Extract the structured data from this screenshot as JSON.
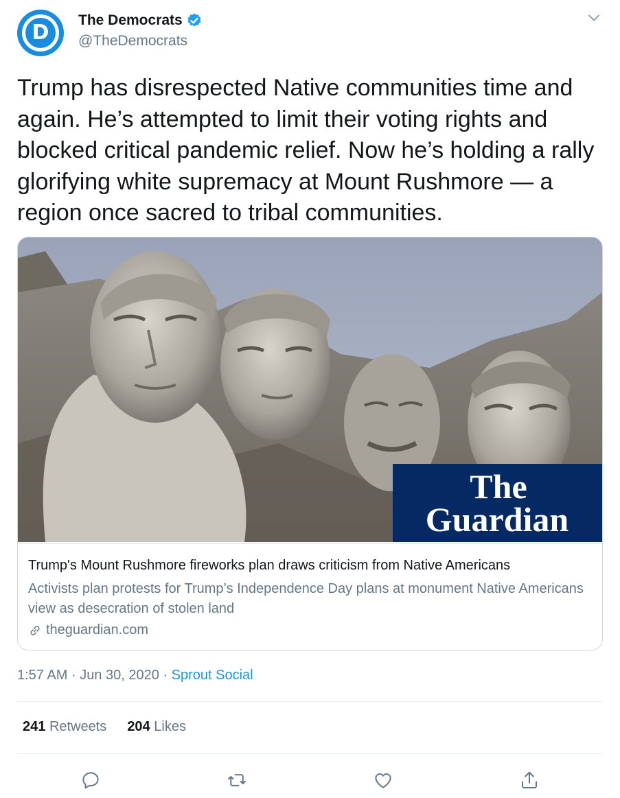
{
  "account": {
    "display_name": "The Democrats",
    "handle": "@TheDemocrats",
    "avatar_letter": "D",
    "verified": true
  },
  "tweet": {
    "text": "Trump has disrespected Native communities time and again. He’s attempted to limit their voting rights and blocked critical pandemic relief. Now he’s holding a rally glorifying white supremacy at Mount Rushmore — a region once sacred to tribal communities.",
    "time": "1:57 AM",
    "date": "Jun 30, 2020",
    "separator": "·",
    "source": "Sprout Social"
  },
  "card": {
    "image_logo_line1": "The",
    "image_logo_line2": "Guardian",
    "title": "Trump's Mount Rushmore fireworks plan draws criticism from Native Americans",
    "description": "Activists plan protests for Trump’s Independence Day plans at monument Native Americans view as desecration of stolen land",
    "domain": "theguardian.com"
  },
  "stats": {
    "retweets_count": "241",
    "retweets_label": "Retweets",
    "likes_count": "204",
    "likes_label": "Likes"
  },
  "actions": {
    "reply": "reply-icon",
    "retweet": "retweet-icon",
    "like": "heart-icon",
    "share": "share-icon"
  },
  "colors": {
    "accent": "#1b95e0",
    "avatar": "#1a8ce0",
    "text_secondary": "#657786",
    "guardian_blue": "#052962"
  }
}
